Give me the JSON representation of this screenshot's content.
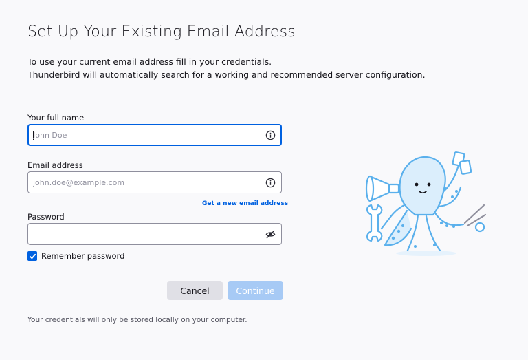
{
  "page": {
    "title": "Set Up Your Existing Email Address",
    "intro_line1": "To use your current email address fill in your credentials.",
    "intro_line2": "Thunderbird will automatically search for a working and recommended server configuration."
  },
  "form": {
    "name": {
      "label": "Your full name",
      "value": "",
      "placeholder": "John Doe",
      "info_icon": "info-circle"
    },
    "email": {
      "label": "Email address",
      "value": "",
      "placeholder": "john.doe@example.com",
      "info_icon": "info-circle"
    },
    "get_new_email_link": "Get a new email address",
    "password": {
      "label": "Password",
      "value": "",
      "visibility_icon": "eye-slash"
    },
    "remember": {
      "label": "Remember password",
      "checked": true
    }
  },
  "buttons": {
    "cancel": "Cancel",
    "continue": "Continue",
    "continue_disabled": true
  },
  "footer": {
    "note": "Your credentials will only be stored locally on your computer."
  },
  "colors": {
    "accent": "#0061e0",
    "background": "#f9f9fb",
    "disabled_button": "#a7caf5",
    "mascot": "#5ab0ec"
  },
  "illustration": {
    "name": "thunderbird-octopus-mascot"
  }
}
